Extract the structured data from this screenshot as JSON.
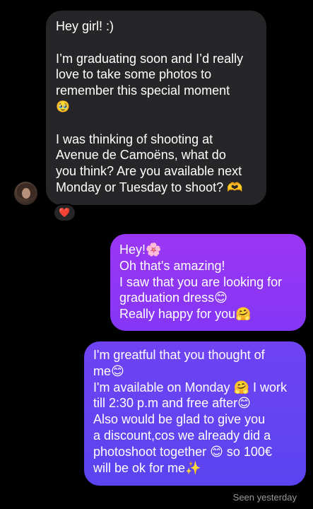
{
  "incoming_message": {
    "lines": [
      "Hey girl! :)",
      "",
      "I’m graduating soon and I’d really",
      "love to take some photos to",
      "remember this special moment",
      "🥹",
      "",
      "I was thinking of shooting at",
      "Avenue de Camoëns, what do",
      "you think? Are you available next",
      "Monday or Tuesday to shoot? 🫶"
    ],
    "reaction": "❤️",
    "bubble_color": "#262629"
  },
  "outgoing_messages": [
    {
      "lines": [
        "Hey!🌸",
        "Oh that's amazing!",
        "I saw that you are looking for",
        "graduation dress😊",
        "Really happy for you🤗"
      ],
      "bubble_color": "#9036f4"
    },
    {
      "lines": [
        "I'm greatful that you thought of",
        "me😊",
        "I'm available on Monday 🤗 I work",
        "till 2:30 p.m and free after😊",
        "Also would be glad to give you",
        "a discount,cos we already did a",
        "photoshoot together 😊 so 100€",
        "will be ok for me✨"
      ],
      "bubble_color": "#6544f1"
    }
  ],
  "seen_status": "Seen yesterday",
  "icons": {
    "avatar": "contact-avatar",
    "reaction": "heart-icon"
  },
  "colors": {
    "background": "#000000",
    "seen_text": "#9a9a9a"
  }
}
